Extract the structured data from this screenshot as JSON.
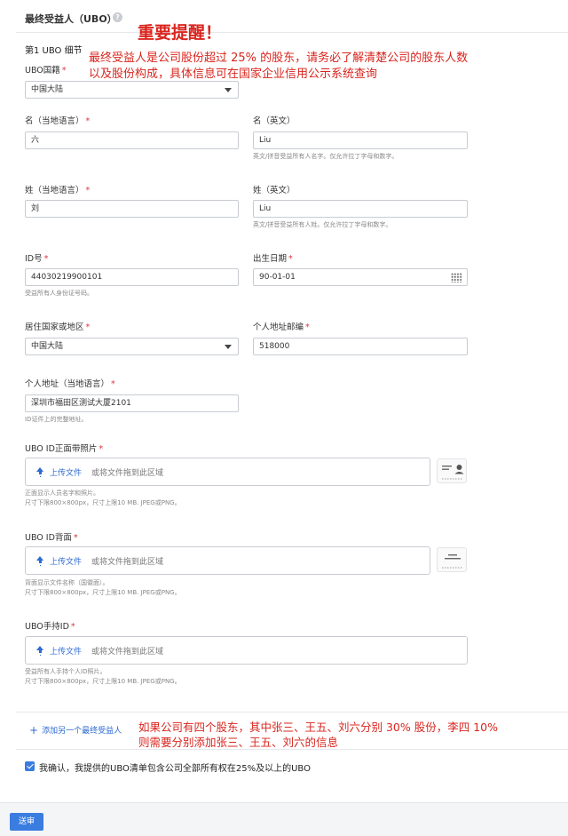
{
  "section": {
    "title": "最终受益人（UBO）",
    "help_glyph": "?",
    "subtitle": "第1 UBO 细节"
  },
  "notice": {
    "headline": "重要提醒！",
    "line1": "最终受益人是公司股份超过 25% 的股东，请务必了解清楚公司的股东人数",
    "line2": "以及股份构成，具体信息可在国家企业信用公示系统查询",
    "color": "#d9251e"
  },
  "fields": {
    "nationality": {
      "label": "UBO国籍",
      "value": "中国大陆"
    },
    "first_name_local": {
      "label": "名（当地语言）",
      "value": "六"
    },
    "first_name_en": {
      "label": "名（英文）",
      "value": "Liu",
      "hint": "英文/拼音受益所有人名字。仅允许拉丁字母和数字。"
    },
    "last_name_local": {
      "label": "姓（当地语言）",
      "value": "刘"
    },
    "last_name_en": {
      "label": "姓（英文）",
      "value": "Liu",
      "hint": "英文/拼音受益所有人姓。仅允许拉丁字母和数字。"
    },
    "id_number": {
      "label": "ID号",
      "value": "44030219900101",
      "hint": "受益所有人身份证号码。"
    },
    "birth_date": {
      "label": "出生日期",
      "value": "90-01-01"
    },
    "residence_country": {
      "label": "居住国家或地区",
      "value": "中国大陆"
    },
    "postal_code": {
      "label": "个人地址邮编",
      "value": "518000"
    },
    "address_local": {
      "label": "个人地址（当地语言）",
      "value": "深圳市福田区测试大厦2101",
      "hint": "ID证件上的完整地址。"
    }
  },
  "required_mark": "*",
  "uploads": {
    "button_label": "上传文件",
    "drop_text": "或将文件拖到此区域",
    "front": {
      "label": "UBO ID正面带照片",
      "hint1": "正面显示人员名字和照片。",
      "hint2": "尺寸下限800×800px，尺寸上限10 MB. JPEG或PNG。"
    },
    "back": {
      "label": "UBO ID背面",
      "hint1": "背面显示文件名称（国徽面）。",
      "hint2": "尺寸下限800×800px，尺寸上限10 MB. JPEG或PNG。"
    },
    "handheld": {
      "label": "UBO手持ID",
      "hint1": "受益所有人手持个人ID照片。",
      "hint2": "尺寸下限800×800px，尺寸上限10 MB. JPEG或PNG。"
    }
  },
  "add_ubo": {
    "icon": "+",
    "label": "添加另一个最终受益人"
  },
  "example": {
    "line1": "如果公司有四个股东，其中张三、王五、刘六分别 30% 股份，李四 10%",
    "line2": "则需要分别添加张三、王五、刘六的信息"
  },
  "confirm": {
    "label": "我确认，我提供的UBO清单包含公司全部所有权在25%及以上的UBO",
    "checked": true
  },
  "submit": {
    "label": "送审"
  }
}
